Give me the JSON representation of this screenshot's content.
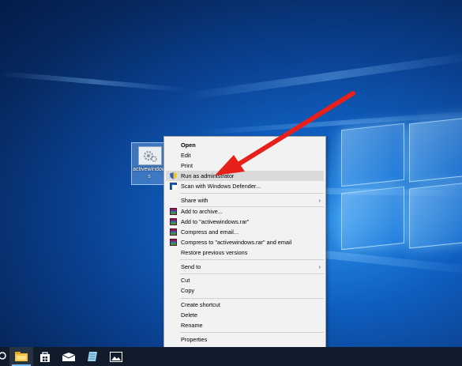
{
  "desktop": {
    "icon_label": "activewindows"
  },
  "context_menu": {
    "open": "Open",
    "edit": "Edit",
    "print": "Print",
    "run_as_admin": "Run as administrator",
    "scan_defender": "Scan with Windows Defender...",
    "share_with": "Share with",
    "add_to_archive": "Add to archive...",
    "add_to_rar": "Add to \"activewindows.rar\"",
    "compress_email": "Compress and email...",
    "compress_rar_email": "Compress to \"activewindows.rar\" and email",
    "restore_versions": "Restore previous versions",
    "send_to": "Send to",
    "cut": "Cut",
    "copy": "Copy",
    "create_shortcut": "Create shortcut",
    "delete": "Delete",
    "rename": "Rename",
    "properties": "Properties"
  },
  "annotation": {
    "arrow_color": "#e8201a"
  },
  "taskbar": {
    "icons": [
      "search-icon",
      "file-explorer-icon",
      "store-icon",
      "mail-icon",
      "notes-icon",
      "photos-icon"
    ]
  }
}
